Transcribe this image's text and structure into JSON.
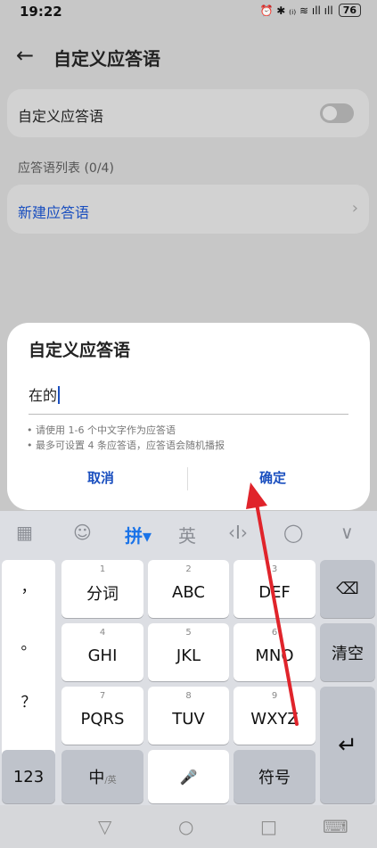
{
  "status_bar": {
    "time": "19:22",
    "indicators": "⏰ ✱ ₍ᵢ₎ ≋ ıll ıll",
    "battery": "76"
  },
  "app_bar": {
    "back_icon": "←",
    "title": "自定义应答语"
  },
  "settings": {
    "toggle_label": "自定义应答语",
    "toggle_on": false,
    "list_header": "应答语列表 (0/4)",
    "new_item_label": "新建应答语",
    "chevron": "›"
  },
  "dialog": {
    "title": "自定义应答语",
    "input_value": "在的",
    "hints": [
      "• 请使用 1-6 个中文字作为应答语",
      "• 最多可设置 4 条应答语，应答语会随机播报"
    ],
    "cancel_label": "取消",
    "confirm_label": "确定"
  },
  "keyboard": {
    "toolbar": {
      "grid": "▦",
      "emoji": "☺",
      "pinyin": "拼▾",
      "english": "英",
      "cursor": "‹I›",
      "search": "◯",
      "collapse": "∨"
    },
    "punctuation": [
      "，",
      "。",
      "？",
      "！"
    ],
    "keys": [
      {
        "num": "1",
        "label": "分词"
      },
      {
        "num": "2",
        "label": "ABC"
      },
      {
        "num": "3",
        "label": "DEF"
      },
      {
        "num": "4",
        "label": "GHI"
      },
      {
        "num": "5",
        "label": "JKL"
      },
      {
        "num": "6",
        "label": "MNO"
      },
      {
        "num": "7",
        "label": "PQRS"
      },
      {
        "num": "8",
        "label": "TUV"
      },
      {
        "num": "9",
        "label": "WXYZ"
      }
    ],
    "delete_icon": "⌫",
    "clear_label": "清空",
    "enter_icon": "↵",
    "num_label": "123",
    "lang_label": "中",
    "lang_sub": "/英",
    "space_icon": "🎤",
    "symbol_label": "符号"
  },
  "nav_bar": {
    "back": "▽",
    "home": "○",
    "recent": "□",
    "keyboard": "⌨"
  },
  "colors": {
    "accent": "#1a4fbf",
    "annotation_arrow": "#e0242b"
  }
}
